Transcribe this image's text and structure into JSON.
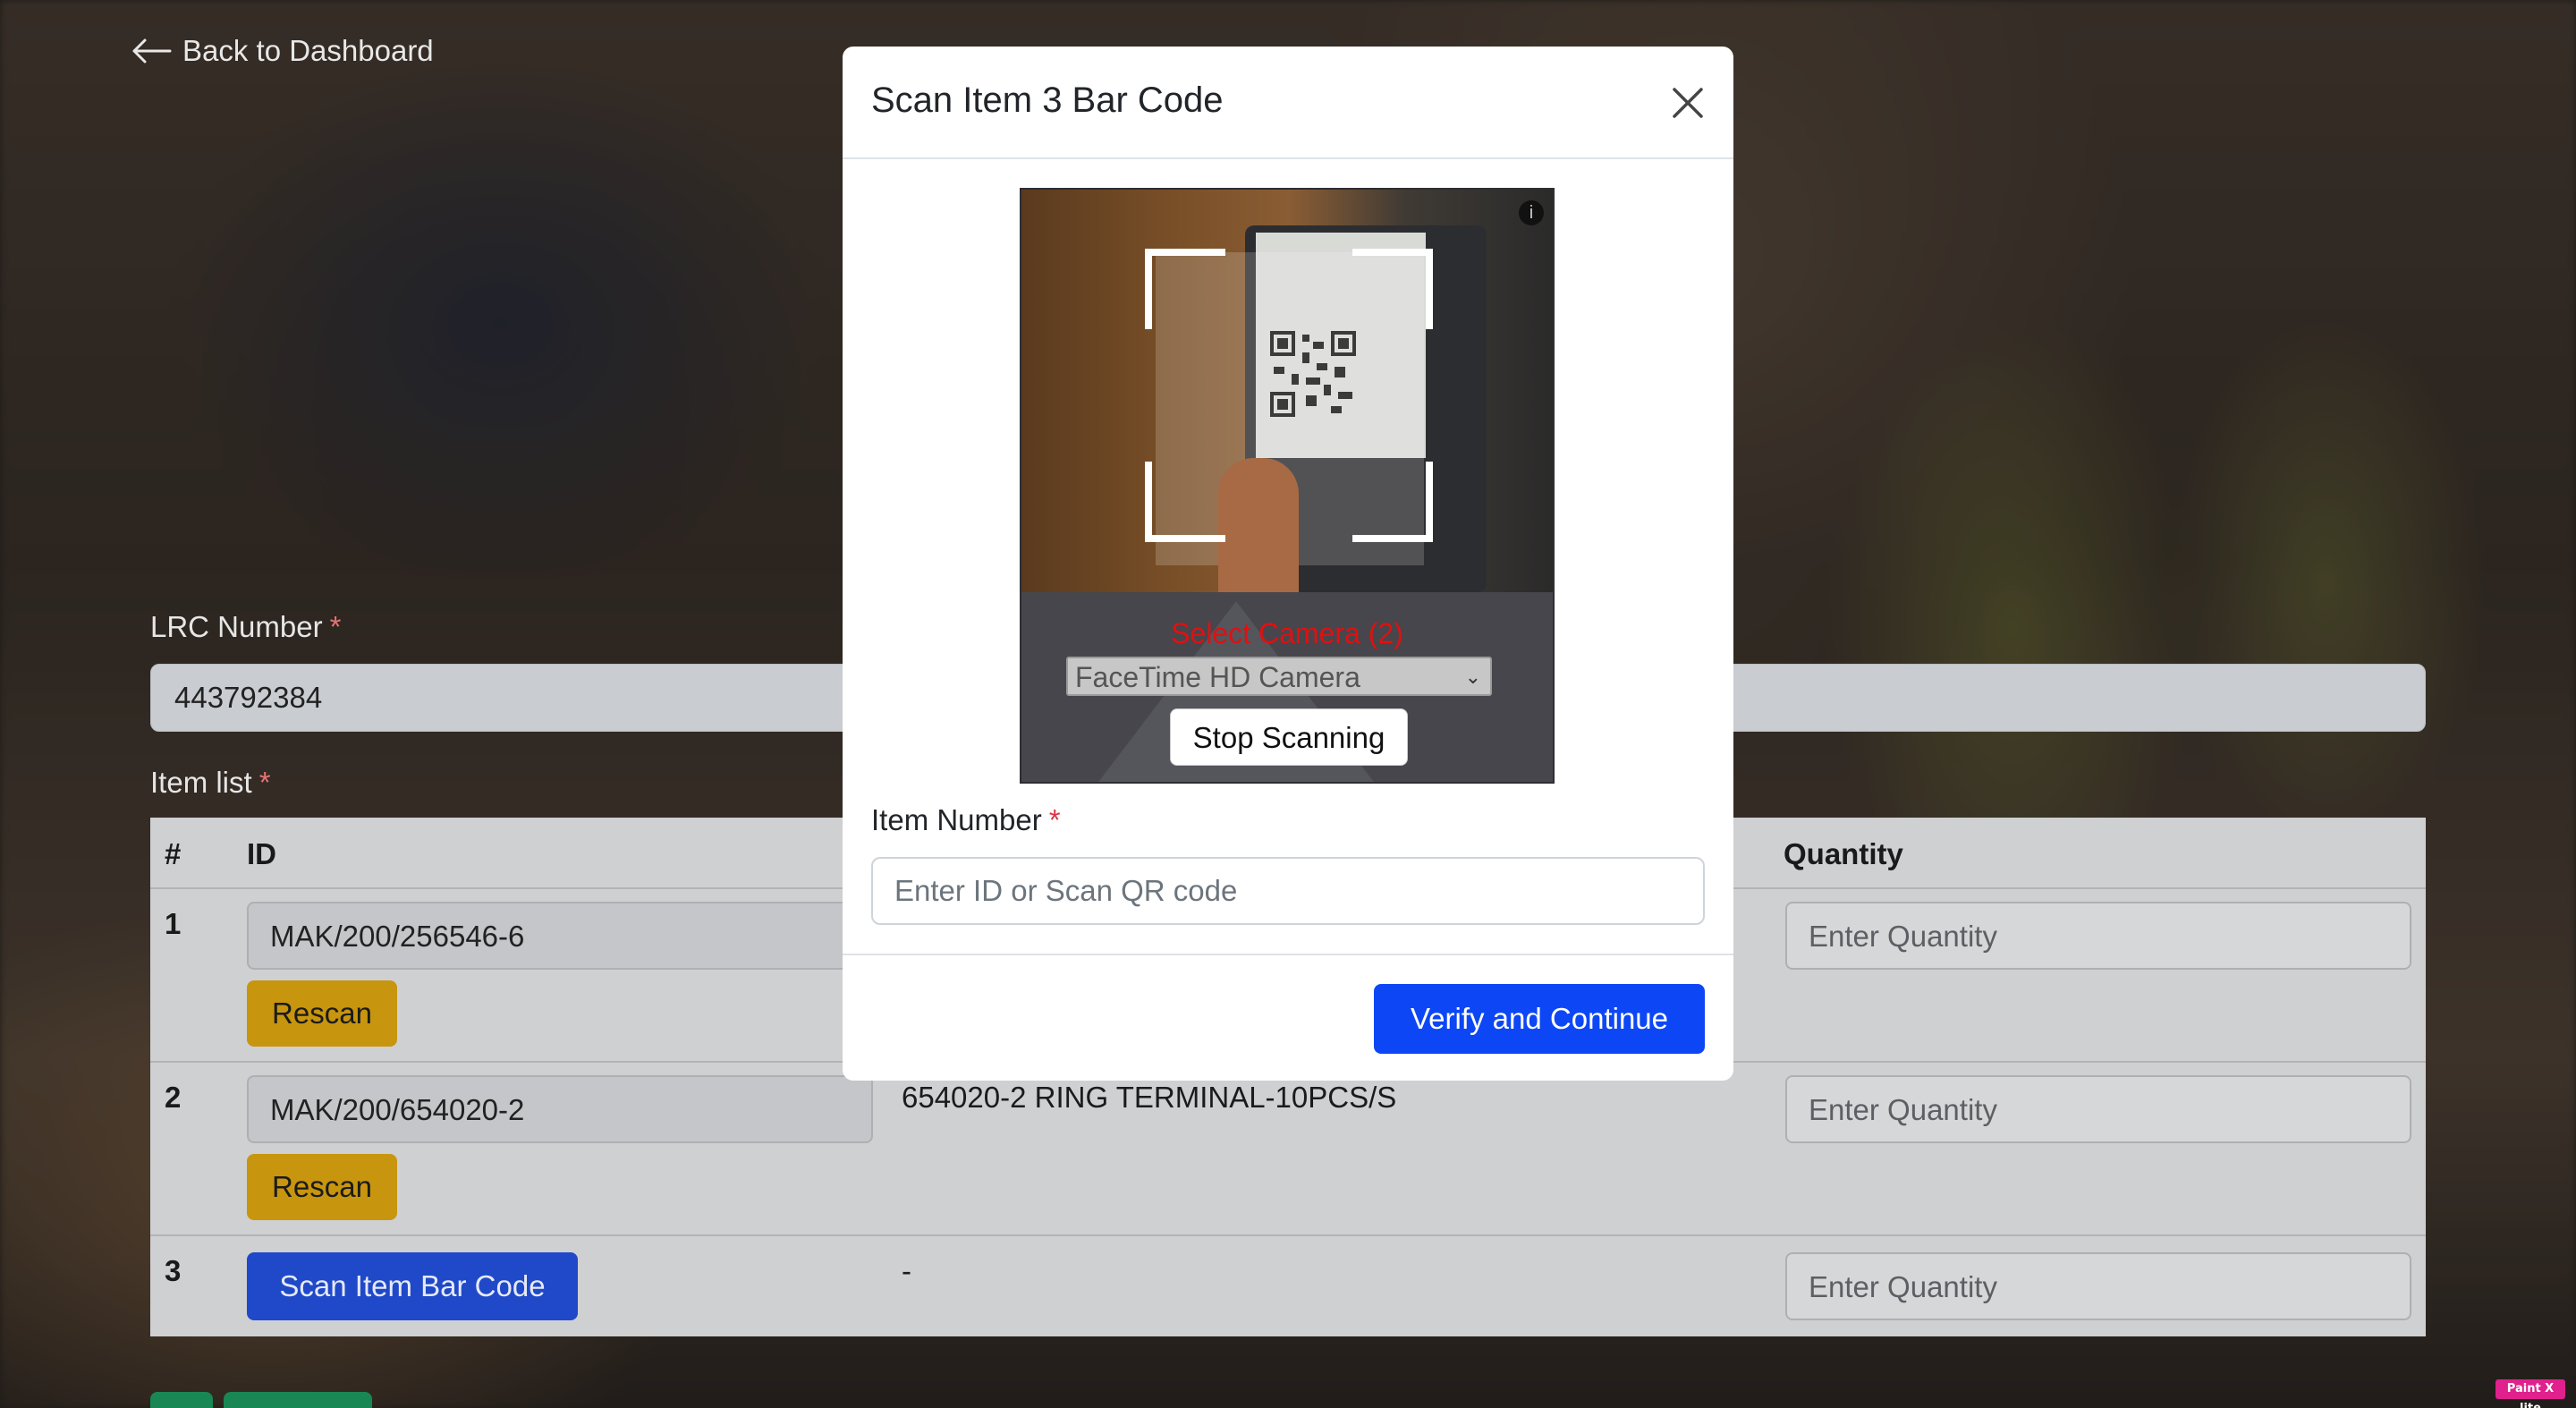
{
  "page": {
    "back_link": "Back to Dashboard",
    "lrc_label": "LRC Number",
    "lrc_required": "*",
    "lrc_value": "443792384",
    "item_list_label": "Item list",
    "item_list_required": "*",
    "table": {
      "headers": {
        "num": "#",
        "id": "ID",
        "quantity": "Quantity"
      },
      "rows": [
        {
          "num": "1",
          "id": "MAK/200/256546-6",
          "rescan": "Rescan",
          "description": "",
          "qty_placeholder": "Enter Quantity"
        },
        {
          "num": "2",
          "id": "MAK/200/654020-2",
          "rescan": "Rescan",
          "description": "654020-2 RING TERMINAL-10PCS/S",
          "qty_placeholder": "Enter Quantity"
        },
        {
          "num": "3",
          "scan_button": "Scan Item Bar Code",
          "description": "-",
          "qty_placeholder": "Enter Quantity"
        }
      ]
    }
  },
  "modal": {
    "title": "Scan Item 3 Bar Code",
    "scanner": {
      "camera_label": "Select Camera (2)",
      "camera_selected": "FaceTime HD Camera",
      "stop_button": "Stop Scanning",
      "info_icon": "info-icon"
    },
    "item_number_label": "Item Number",
    "item_number_required": "*",
    "item_number_placeholder": "Enter ID or Scan QR code",
    "verify_button": "Verify and Continue"
  },
  "badge": "Paint X lite",
  "colors": {
    "primary": "#0d47f5",
    "warning": "#c8950f",
    "danger": "#dc3545",
    "camera_label": "#e01010"
  }
}
